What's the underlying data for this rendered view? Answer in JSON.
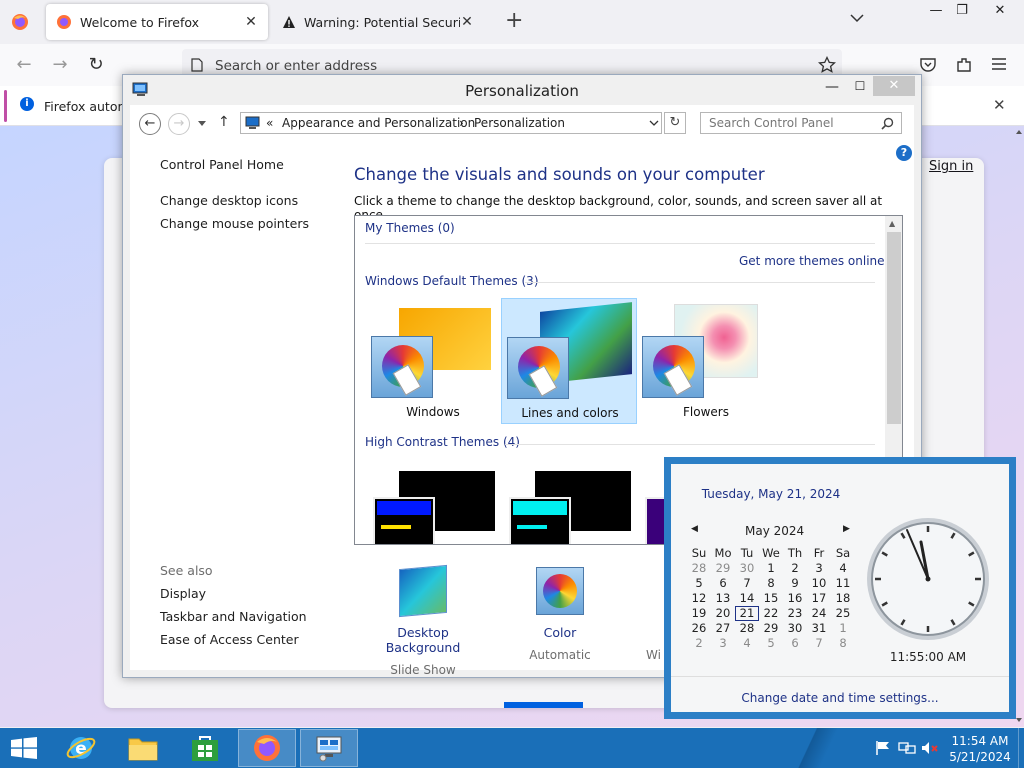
{
  "firefox": {
    "tabs": [
      {
        "title": "Welcome to Firefox",
        "active": true
      },
      {
        "title": "Warning: Potential Security Risk",
        "active": false
      }
    ],
    "url_placeholder": "Search or enter address",
    "notification": "Firefox automa",
    "sign_in": "Sign in"
  },
  "control_panel": {
    "window_title": "Personalization",
    "breadcrumb": {
      "sep_back": "«",
      "part1": "Appearance and Personalization",
      "sep": "›",
      "part2": "Personalization"
    },
    "search_placeholder": "Search Control Panel",
    "help": "?",
    "sidebar": {
      "home": "Control Panel Home",
      "links": [
        "Change desktop icons",
        "Change mouse pointers"
      ],
      "see_also_header": "See also",
      "see_also": [
        "Display",
        "Taskbar and Navigation",
        "Ease of Access Center"
      ]
    },
    "heading": "Change the visuals and sounds on your computer",
    "subheading": "Click a theme to change the desktop background, color, sounds, and screen saver all at once.",
    "groups": {
      "my_themes": "My Themes (0)",
      "get_more": "Get more themes online",
      "default_themes": "Windows Default Themes (3)",
      "high_contrast": "High Contrast Themes (4)"
    },
    "themes": [
      {
        "name": "Windows",
        "selected": false
      },
      {
        "name": "Lines and colors",
        "selected": true
      },
      {
        "name": "Flowers",
        "selected": false
      }
    ],
    "bottom": [
      {
        "title": "Desktop Background",
        "value": "Slide Show"
      },
      {
        "title": "Color",
        "value": "Automatic"
      },
      {
        "title": "Wi",
        "value": ""
      }
    ]
  },
  "clock": {
    "long_date": "Tuesday, May 21, 2024",
    "month": "May 2024",
    "prev": "◀",
    "next": "▶",
    "weekdays": [
      "Su",
      "Mo",
      "Tu",
      "We",
      "Th",
      "Fr",
      "Sa"
    ],
    "weeks": [
      [
        "28",
        "29",
        "30",
        "1",
        "2",
        "3",
        "4"
      ],
      [
        "5",
        "6",
        "7",
        "8",
        "9",
        "10",
        "11"
      ],
      [
        "12",
        "13",
        "14",
        "15",
        "16",
        "17",
        "18"
      ],
      [
        "19",
        "20",
        "21",
        "22",
        "23",
        "24",
        "25"
      ],
      [
        "26",
        "27",
        "28",
        "29",
        "30",
        "31",
        "1"
      ],
      [
        "2",
        "3",
        "4",
        "5",
        "6",
        "7",
        "8"
      ]
    ],
    "today": "21",
    "time": "11:55:00 AM",
    "settings_link": "Change date and time settings..."
  },
  "taskbar": {
    "time": "11:54 AM",
    "date": "5/21/2024"
  },
  "colors": {
    "accent": "#1e3287",
    "taskbar": "#1a6fb8",
    "selection": "#cce8ff"
  }
}
